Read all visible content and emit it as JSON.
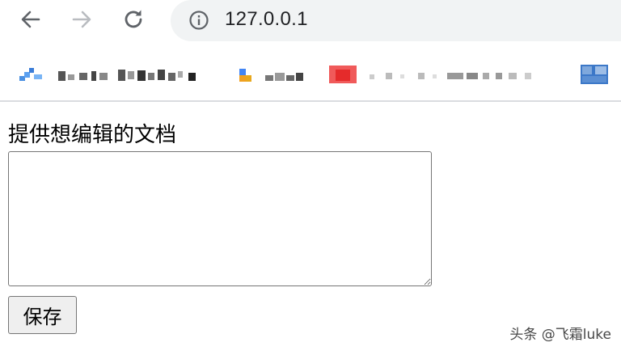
{
  "browser": {
    "url": "127.0.0.1",
    "icons": {
      "back": "arrow-left-icon",
      "forward": "arrow-right-icon",
      "reload": "reload-icon",
      "site_info": "info-icon"
    }
  },
  "page": {
    "label": "提供想编辑的文档",
    "textarea_value": "",
    "save_label": "保存"
  },
  "watermark": "头条 @飞霜luke",
  "colors": {
    "omnibox_bg": "#f1f3f4",
    "button_bg": "#efefef",
    "border": "#767676"
  }
}
